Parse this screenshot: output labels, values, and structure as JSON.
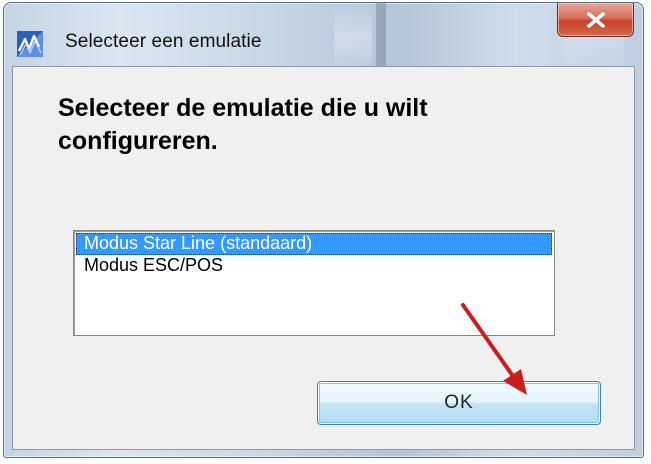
{
  "window": {
    "title": "Selecteer een emulatie",
    "icon": "emulation-app-icon",
    "close_icon": "close-icon"
  },
  "dialog": {
    "prompt": "Selecteer de emulatie die u wilt configureren.",
    "emulations": [
      {
        "label": "Modus Star Line (standaard)",
        "selected": true
      },
      {
        "label": "Modus ESC/POS",
        "selected": false
      }
    ],
    "ok_label": "OK"
  },
  "annotation": {
    "arrow_color": "#c81e1e",
    "arrow_icon": "red-arrow-pointer"
  },
  "colors": {
    "selection": "#3399ff",
    "close_button": "#c5412b",
    "ok_button_border": "#3c7fb1"
  }
}
